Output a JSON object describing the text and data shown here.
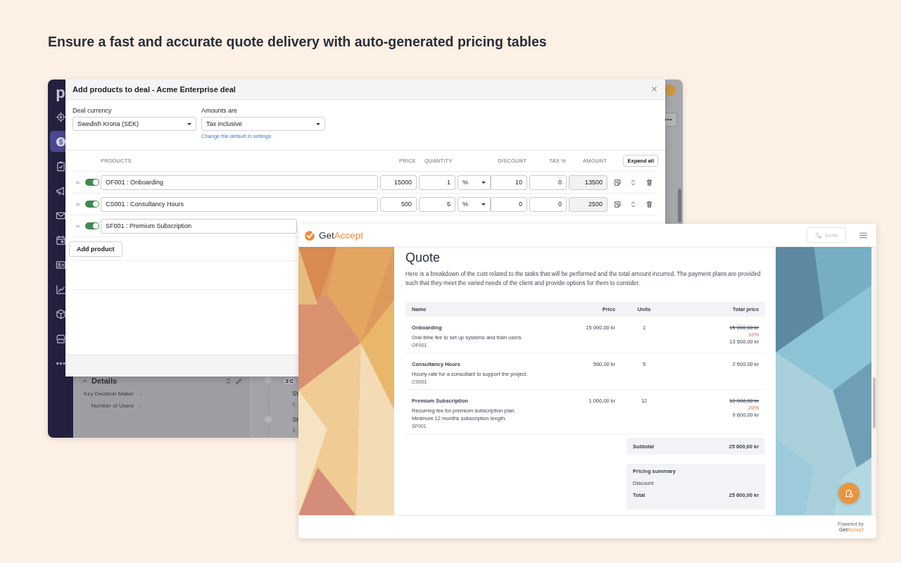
{
  "headline": "Ensure a fast and accurate quote delivery with auto-generated pricing tables",
  "crm_window": {
    "logo": "p",
    "sidebar": {
      "items": [
        {
          "kind": "target",
          "selected": false
        },
        {
          "kind": "dollar",
          "selected": true
        },
        {
          "kind": "clipboard",
          "selected": false
        },
        {
          "kind": "megaphone",
          "selected": false
        },
        {
          "kind": "mail",
          "selected": false
        },
        {
          "kind": "calendar",
          "selected": false
        },
        {
          "kind": "contact",
          "selected": false
        },
        {
          "kind": "chart",
          "selected": false
        },
        {
          "kind": "box",
          "selected": false
        },
        {
          "kind": "store",
          "selected": false
        },
        {
          "kind": "more",
          "selected": false
        }
      ]
    },
    "details": {
      "title": "Details",
      "fields": [
        {
          "label": "Key Decision Maker",
          "value": "-"
        },
        {
          "label": "Number of Users",
          "value": "-"
        }
      ]
    },
    "timeline": {
      "badge": "2 C",
      "entries": [
        {
          "title": "St",
          "meta": "3 ."
        },
        {
          "title": "St",
          "meta": "3 ."
        }
      ]
    },
    "modal": {
      "title": "Add products to deal - Acme Enterprise deal",
      "currency": {
        "label": "Deal currency",
        "value": "Swedish Krona (SEK)"
      },
      "amounts": {
        "label": "Amounts are",
        "value": "Tax inclusive",
        "link": "Change the default in settings"
      },
      "columns": [
        "PRODUCTS",
        "PRICE",
        "QUANTITY",
        "DISCOUNT",
        "TAX %",
        "AMOUNT"
      ],
      "expand_all": "Expand all",
      "rows": [
        {
          "enabled": true,
          "product": "OF001 : Onboarding",
          "price": "15000",
          "quantity": "1",
          "discount_type": "%",
          "discount": "10",
          "tax": "0",
          "amount": "13500"
        },
        {
          "enabled": true,
          "product": "CS001 : Consultancy Hours",
          "price": "500",
          "quantity": "5",
          "discount_type": "%",
          "discount": "0",
          "tax": "0",
          "amount": "2500"
        },
        {
          "enabled": true,
          "product": "SF001 : Premium Subscription"
        }
      ],
      "add_product": "Add product"
    }
  },
  "quote_window": {
    "logo": [
      "Get",
      "Accept"
    ],
    "invite": {
      "label": "Invite",
      "disabled": true
    },
    "title": "Quote",
    "intro": "Here is a breakdown of the cost related to the tasks that will be performed and the total amount incurred. The payment plans are provided such that they meet the varied needs of the client and provide options for them to consider.",
    "columns": [
      "Name",
      "Price",
      "Units",
      "Total price"
    ],
    "rows": [
      {
        "name": "Onboarding",
        "description": [
          "One-time fee to set up systems and train users."
        ],
        "code": "OF001",
        "price": "15 000,00 kr",
        "units": "1",
        "original_total": "15 000,00 kr",
        "discount": "10%",
        "total": "13 500,00 kr"
      },
      {
        "name": "Consultancy Hours",
        "description": [
          "Hourly rate for a consultant to support the project."
        ],
        "code": "CS001",
        "price": "500,00 kr",
        "units": "5",
        "total": "2 500,00 kr"
      },
      {
        "name": "Premium Subscription",
        "description": [
          "Recurring fee for premium subscription plan.",
          "Minimum 12 months subscription length."
        ],
        "code": "SF001",
        "price": "1 000,00 kr",
        "units": "12",
        "original_total": "12 000,00 kr",
        "discount": "20%",
        "total": "9 600,00 kr"
      }
    ],
    "subtotal": {
      "label": "Subtotal",
      "value": "25 600,00 kr"
    },
    "summary": {
      "title": "Pricing summary",
      "rows": [
        {
          "kind": "line",
          "label": "Discount"
        },
        {
          "kind": "total",
          "label": "Total",
          "value": "25 600,00 kr"
        }
      ]
    },
    "footer": {
      "powered_by": "Powered by",
      "brand": [
        "Get",
        "Accept"
      ]
    }
  }
}
